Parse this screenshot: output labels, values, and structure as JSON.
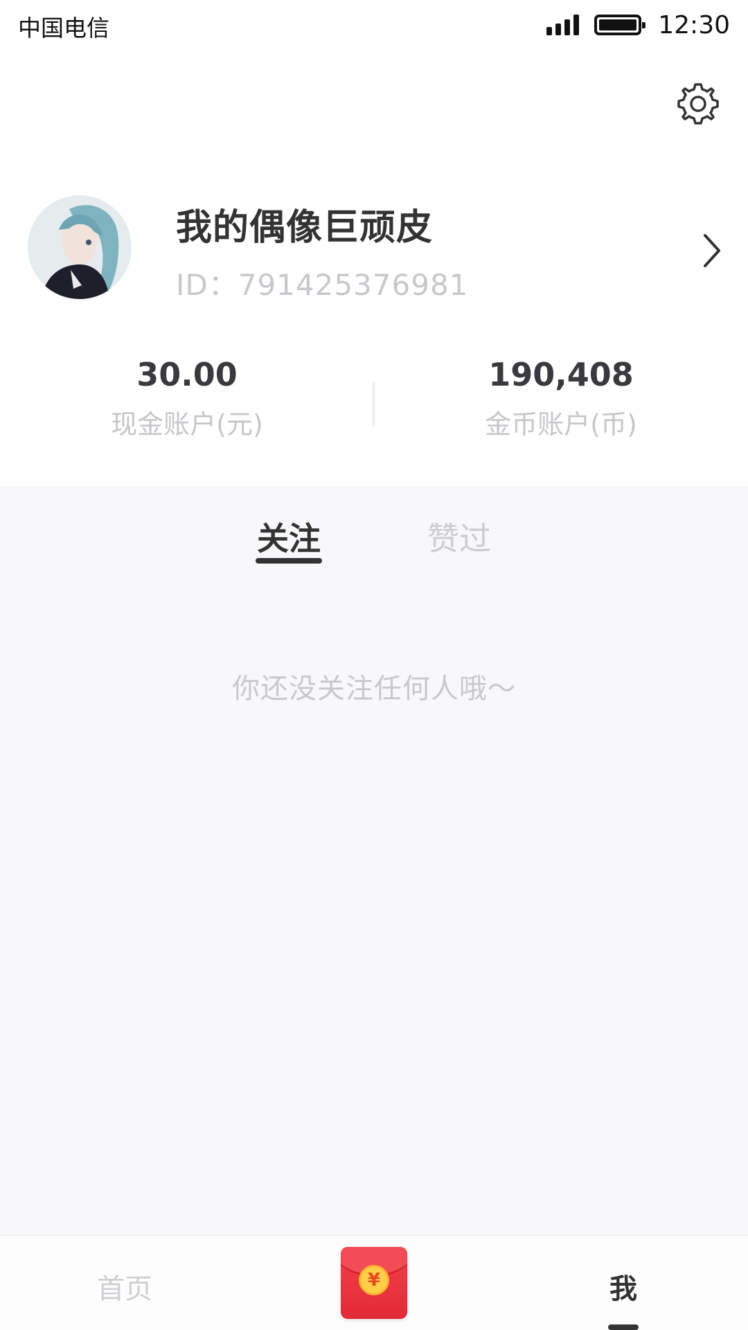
{
  "status_bar": {
    "carrier": "中国电信",
    "time": "12:30",
    "signal_icon": "signal-bars-icon",
    "battery_icon": "battery-full-icon"
  },
  "header": {
    "settings_icon": "gear-icon"
  },
  "profile": {
    "nickname": "我的偶像巨顽皮",
    "id_text": "ID：791425376981",
    "avatar": "anime-character-avatar",
    "arrow_icon": "chevron-right-icon"
  },
  "accounts": {
    "cash": {
      "value": "30.00",
      "label": "现金账户(元)"
    },
    "coins": {
      "value": "190,408",
      "label": "金币账户(币)"
    }
  },
  "tabs": {
    "items": [
      {
        "label": "关注",
        "active": true
      },
      {
        "label": "赞过",
        "active": false
      }
    ]
  },
  "empty_state": {
    "text": "你还没关注任何人哦～"
  },
  "bottom_nav": {
    "home_label": "首页",
    "redpacket_icon": "red-packet-icon",
    "redpacket_symbol": "¥",
    "me_label": "我"
  },
  "colors": {
    "background": "#ffffff",
    "content_background": "#f8f7fa",
    "primary_text": "#333333",
    "secondary_text": "#c8c8cc",
    "red_packet": "#f4414d",
    "coin": "#ffcf4a"
  }
}
